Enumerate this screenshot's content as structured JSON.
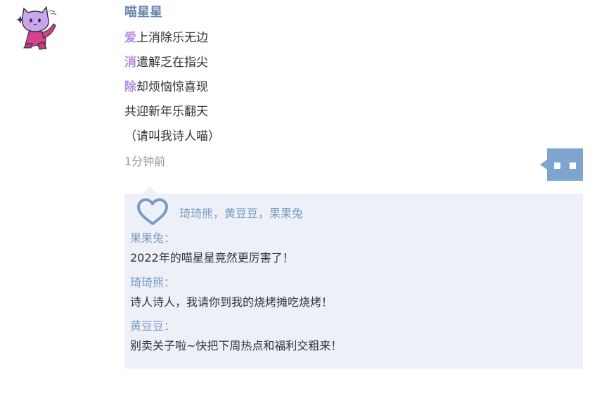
{
  "post": {
    "username": "喵星星",
    "lines": [
      {
        "acro": "爱",
        "rest": "上消除乐无边"
      },
      {
        "acro": "消",
        "rest": "遣解乏在指尖"
      },
      {
        "acro": "除",
        "rest": "却烦恼惊喜现"
      },
      {
        "acro": "",
        "rest": "共迎新年乐翻天"
      },
      {
        "acro": "",
        "rest": "（请叫我诗人喵）"
      }
    ],
    "time": "1分钟前"
  },
  "likes": {
    "icon": "heart-icon",
    "names": "琦琦熊，黄豆豆，果果兔"
  },
  "comments": [
    {
      "author": "果果兔：",
      "text": "2022年的喵星星竟然更厉害了！"
    },
    {
      "author": "琦琦熊：",
      "text": "诗人诗人，我请你到我的烧烤摊吃烧烤！"
    },
    {
      "author": "黄豆豆：",
      "text": "别卖关子啦~快把下周热点和福利交粗来！"
    }
  ],
  "colors": {
    "accent": "#6a86ad",
    "acrostic": "#b48ddf",
    "link": "#7a9cc4",
    "button": "#7ea5cf",
    "comment_bg": "#eef0f8"
  }
}
